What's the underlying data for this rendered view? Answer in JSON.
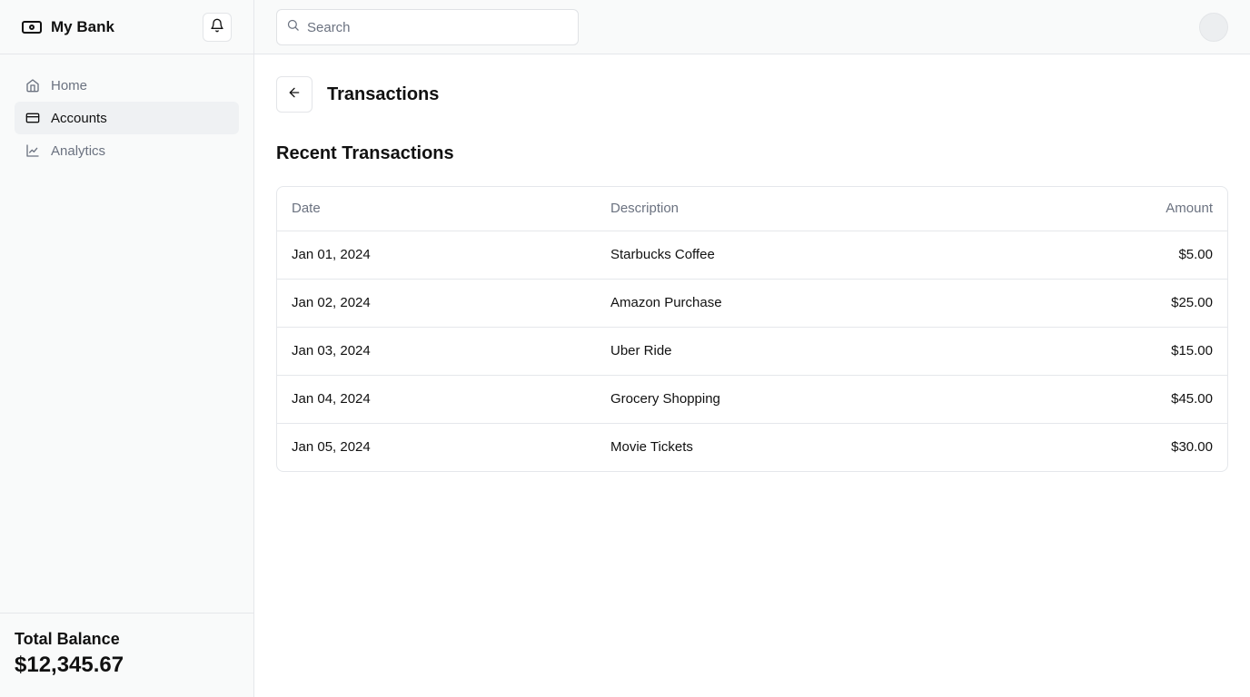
{
  "sidebar": {
    "brand": "My Bank",
    "brand_icon": "banknote-icon",
    "nav": [
      {
        "label": "Home",
        "icon": "home-icon",
        "active": false
      },
      {
        "label": "Accounts",
        "icon": "credit-card-icon",
        "active": true
      },
      {
        "label": "Analytics",
        "icon": "line-chart-icon",
        "active": false
      }
    ],
    "balance_label": "Total Balance",
    "balance_value": "$12,345.67"
  },
  "topbar": {
    "search_placeholder": "Search",
    "search_value": ""
  },
  "main": {
    "page_title": "Transactions",
    "section_title": "Recent Transactions",
    "columns": [
      "Date",
      "Description",
      "Amount"
    ],
    "rows": [
      {
        "date": "Jan 01, 2024",
        "description": "Starbucks Coffee",
        "amount": "$5.00"
      },
      {
        "date": "Jan 02, 2024",
        "description": "Amazon Purchase",
        "amount": "$25.00"
      },
      {
        "date": "Jan 03, 2024",
        "description": "Uber Ride",
        "amount": "$15.00"
      },
      {
        "date": "Jan 04, 2024",
        "description": "Grocery Shopping",
        "amount": "$45.00"
      },
      {
        "date": "Jan 05, 2024",
        "description": "Movie Tickets",
        "amount": "$30.00"
      }
    ]
  },
  "colors": {
    "sidebar_bg": "#f9fafa",
    "border": "#e5e7eb",
    "active_nav_bg": "#eff1f3",
    "muted_text": "#6b7280"
  }
}
